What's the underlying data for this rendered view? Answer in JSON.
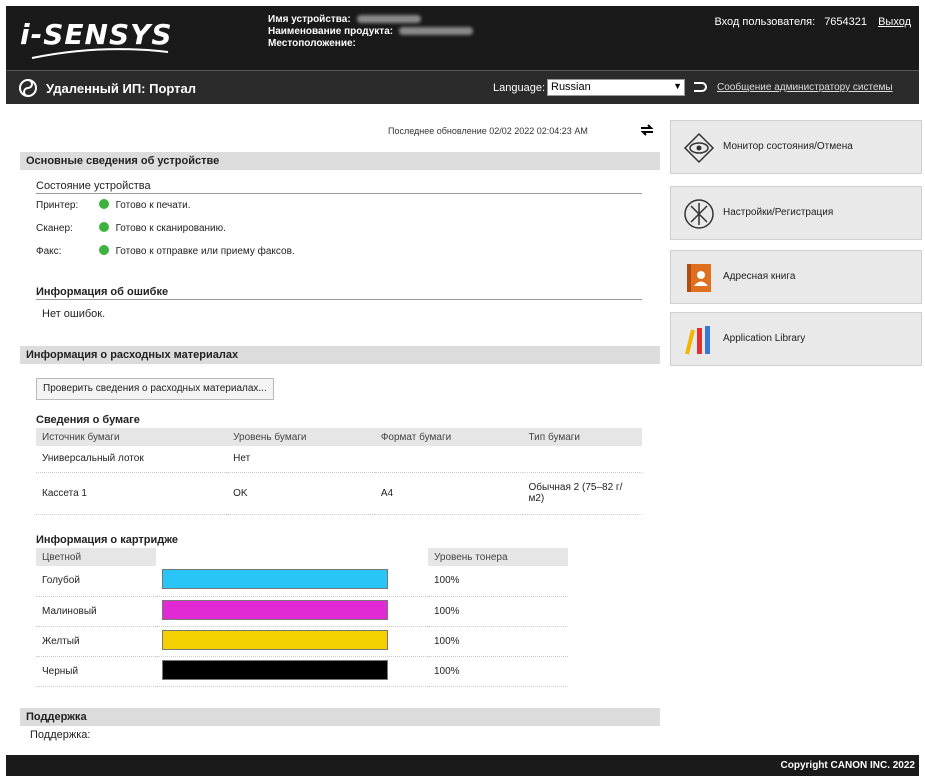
{
  "header": {
    "logo": "i-SENSYS",
    "device_name_label": "Имя устройства:",
    "product_name_label": "Наименование продукта:",
    "location_label": "Местоположение:",
    "login_label": "Вход пользователя:",
    "login_user": "7654321",
    "logout": "Выход"
  },
  "portal": {
    "title": "Удаленный ИП: Портал",
    "language_label": "Language:",
    "language_value": "Russian",
    "admin_link": "Сообщение администратору системы"
  },
  "main": {
    "last_updated": "Последнее обновление 02/02 2022 02:04:23 AM",
    "device_info": {
      "heading": "Основные сведения об устройстве",
      "status_heading": "Состояние устройства",
      "rows": [
        {
          "label": "Принтер:",
          "status": "Готово к печати."
        },
        {
          "label": "Сканер:",
          "status": "Готово к сканированию."
        },
        {
          "label": "Факс:",
          "status": "Готово к отправке или приему факсов."
        }
      ],
      "error_heading": "Информация об ошибке",
      "error_text": "Нет ошибок."
    },
    "consumables": {
      "heading": "Информация о расходных материалах",
      "check_button": "Проверить сведения о расходных материалах...",
      "paper_heading": "Сведения о бумаге",
      "paper_columns": [
        "Источник бумаги",
        "Уровень бумаги",
        "Формат бумаги",
        "Тип бумаги"
      ],
      "paper_rows": [
        [
          "Универсальный лоток",
          "Нет",
          "",
          ""
        ],
        [
          "Кассета 1",
          "OK",
          "A4",
          "Обычная 2 (75–82 г/м2)"
        ]
      ],
      "cartridge_heading": "Информация о картридже",
      "cartridge_columns": [
        "Цветной",
        "",
        "Уровень тонера"
      ],
      "cartridges": [
        {
          "name": "Голубой",
          "level": "100%",
          "color": "#29c5f6"
        },
        {
          "name": "Малиновый",
          "level": "100%",
          "color": "#e22ad4"
        },
        {
          "name": "Желтый",
          "level": "100%",
          "color": "#f5d000"
        },
        {
          "name": "Черный",
          "level": "100%",
          "color": "#000000"
        }
      ]
    },
    "support": {
      "heading": "Поддержка",
      "label": "Поддержка:"
    }
  },
  "menu": [
    {
      "label": "Монитор состояния/Отмена",
      "icon": "eye-monitor-icon"
    },
    {
      "label": "Настройки/Регистрация",
      "icon": "settings-icon"
    },
    {
      "label": "Адресная книга",
      "icon": "address-book-icon"
    },
    {
      "label": "Application Library",
      "icon": "app-library-icon"
    }
  ],
  "footer": {
    "copyright": "Copyright CANON INC. 2022"
  }
}
